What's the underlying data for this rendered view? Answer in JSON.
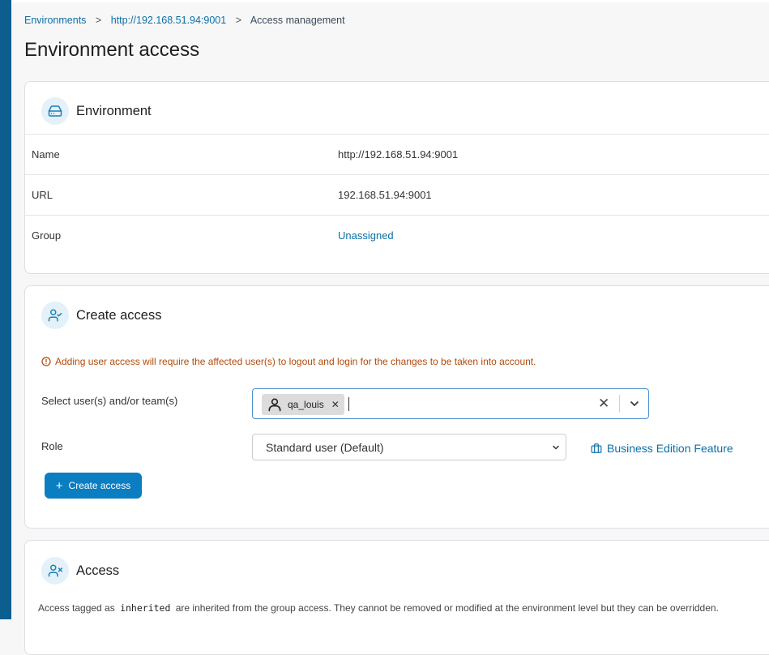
{
  "breadcrumb": {
    "item1": "Environments",
    "sep1": ">",
    "item2": "http://192.168.51.94:9001",
    "sep2": ">",
    "item3": "Access management"
  },
  "page": {
    "title": "Environment access"
  },
  "environment_card": {
    "title": "Environment",
    "icon": "hard-drive-icon",
    "rows": [
      {
        "label": "Name",
        "value": "http://192.168.51.94:9001"
      },
      {
        "label": "URL",
        "value": "192.168.51.94:9001"
      },
      {
        "label": "Group",
        "value": "Unassigned"
      }
    ]
  },
  "create_access": {
    "title": "Create access",
    "icon": "user-check-icon",
    "warning": "Adding user access will require the affected user(s) to logout and login for the changes to be taken into account.",
    "users_label": "Select user(s) and/or team(s)",
    "selected_users": [
      "qa_louis"
    ],
    "role_label": "Role",
    "role_value": "Standard user (Default)",
    "business_feature": "Business Edition Feature",
    "button_label": "Create access"
  },
  "access": {
    "title": "Access",
    "icon": "user-x-icon",
    "desc_before": "Access tagged as",
    "desc_code": "inherited",
    "desc_after": "are inherited from the group access. They cannot be removed or modified at the environment level but they can be overridden."
  },
  "colors": {
    "sidebar": "#0b5e8e",
    "link": "#0b6fa6",
    "primary_button": "#0b7dc1",
    "warning": "#b24a0b"
  }
}
